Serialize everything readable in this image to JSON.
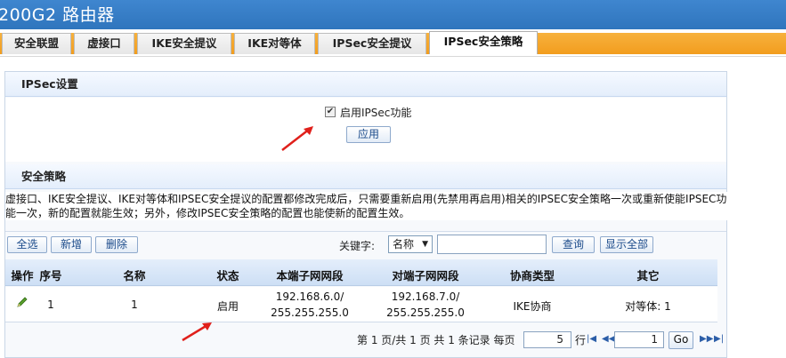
{
  "header": {
    "title": "200G2 路由器"
  },
  "tabs": [
    {
      "label": "安全联盟"
    },
    {
      "label": "虚接口"
    },
    {
      "label": "IKE安全提议"
    },
    {
      "label": "IKE对等体"
    },
    {
      "label": "IPSec安全提议"
    },
    {
      "label": "IPSec安全策略",
      "active": true
    }
  ],
  "ipsec_settings": {
    "section_title": "IPSec设置",
    "enable_label": "启用IPSec功能",
    "enable_checked": true,
    "apply_label": "应用"
  },
  "security_policy": {
    "section_title": "安全策略",
    "description": "虚接口、IKE安全提议、IKE对等体和IPSEC安全提议的配置都修改完成后，只需要重新启用(先禁用再启用)相关的IPSEC安全策略一次或重新使能IPSEC功能一次，新的配置就能生效；另外，修改IPSEC安全策略的配置也能使新的配置生效。",
    "toolbar": {
      "select_all": "全选",
      "add": "新增",
      "delete": "删除",
      "keyword_label": "关键字:",
      "keyword_field_value": "名称",
      "search_value": "",
      "search_button": "查询",
      "show_all_button": "显示全部"
    },
    "columns": [
      "操作",
      "序号",
      "名称",
      "状态",
      "本端子网网段",
      "对端子网网段",
      "协商类型",
      "其它"
    ],
    "rows": [
      {
        "index": "1",
        "name": "1",
        "status": "启用",
        "local_ip": "192.168.6.0/",
        "local_mask": "255.255.255.0",
        "remote_ip": "192.168.7.0/",
        "remote_mask": "255.255.255.0",
        "negotiation": "IKE协商",
        "other": "对等体: 1"
      }
    ],
    "pagination": {
      "info": "第 1 页/共 1 页 共 1 条记录 每页",
      "per_page": "5",
      "rows_label": "行",
      "current_page": "1",
      "go_label": "Go"
    }
  },
  "annotations": {
    "arrow_color": "#e0201b"
  },
  "colors": {
    "header_blue": "#2f75bd",
    "tab_orange": "#f4a62a",
    "section_blue": "#dce8f8"
  }
}
